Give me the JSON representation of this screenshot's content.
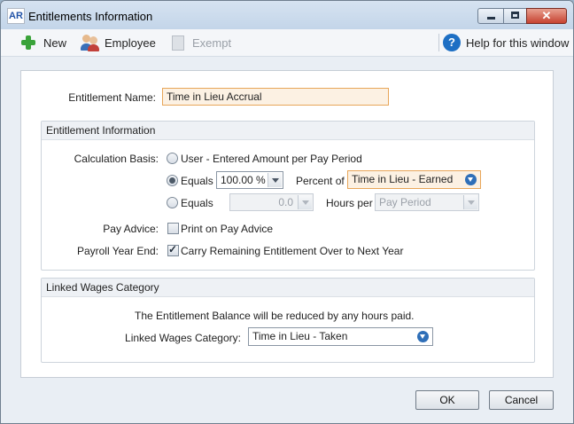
{
  "window": {
    "app_badge": "AR",
    "title": "Entitlements Information",
    "close_glyph": "✕"
  },
  "toolbar": {
    "new_label": "New",
    "employee_label": "Employee",
    "exempt_label": "Exempt",
    "help_label": "Help for this window",
    "help_glyph": "?"
  },
  "form": {
    "entitlement_name_label": "Entitlement Name:",
    "entitlement_name_value": "Time in Lieu Accrual"
  },
  "entitlement_info": {
    "title": "Entitlement Information",
    "calc_basis_label": "Calculation Basis:",
    "option_user_label": "User - Entered Amount per Pay Period",
    "option_equals_label": "Equals",
    "percent_value": "100.00 %",
    "percent_of_label": "Percent of",
    "percent_of_value": "Time in Lieu - Earned",
    "option_equals2_label": "Equals",
    "hours_value": "0.0",
    "hours_per_label": "Hours per",
    "hours_per_value": "Pay Period",
    "selected_option": "equals-percent",
    "pay_advice_label": "Pay Advice:",
    "print_on_pay_advice_label": "Print on Pay Advice",
    "print_on_pay_advice_checked": false,
    "payroll_year_end_label": "Payroll Year End:",
    "carry_over_label": "Carry Remaining Entitlement Over to Next Year",
    "carry_over_checked": true
  },
  "linked_wages": {
    "title": "Linked Wages Category",
    "info_text": "The Entitlement Balance will be reduced by any hours paid.",
    "category_label": "Linked Wages Category:",
    "category_value": "Time in Lieu - Taken"
  },
  "footer": {
    "ok_label": "OK",
    "cancel_label": "Cancel"
  },
  "colors": {
    "highlight_field_border": "#e8a659",
    "highlight_field_bg": "#fcf1e3",
    "window_bg": "#e9eef4"
  }
}
